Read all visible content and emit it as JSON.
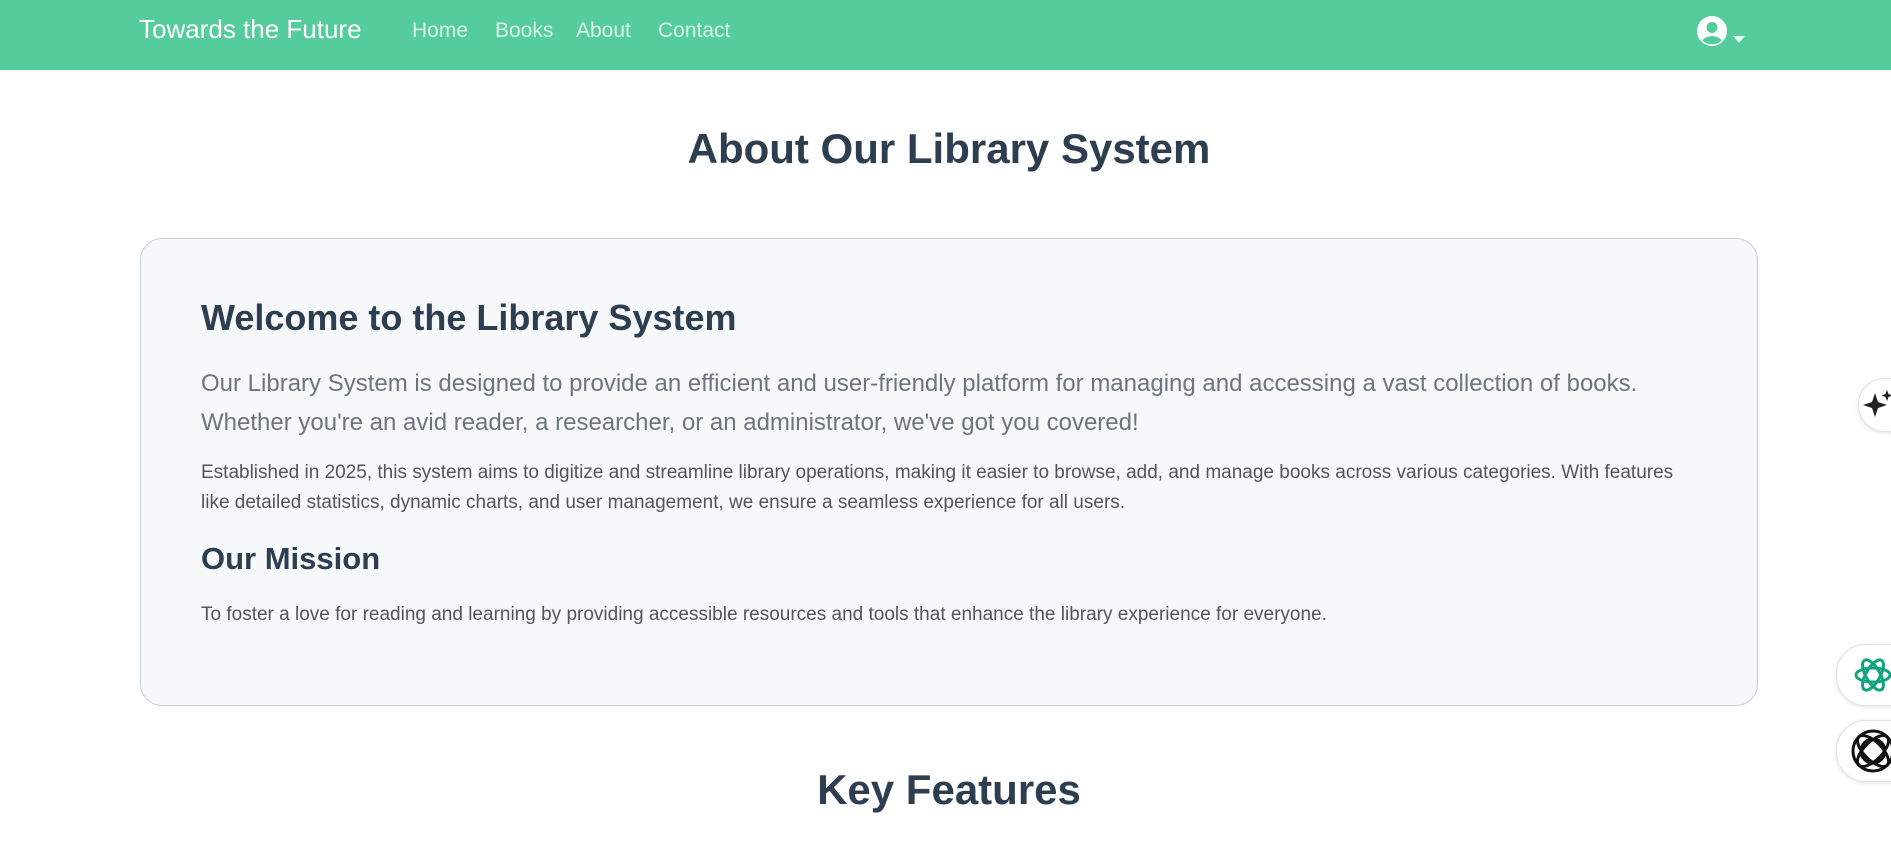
{
  "navbar": {
    "brand": "Towards the Future",
    "links": [
      {
        "label": "Home"
      },
      {
        "label": "Books"
      },
      {
        "label": "About"
      },
      {
        "label": "Contact"
      }
    ],
    "user_icon": "user-circle-icon",
    "caret_icon": "caret-down-icon",
    "background": "#55cc9c"
  },
  "page": {
    "title": "About Our Library System"
  },
  "card": {
    "title": "Welcome to the Library System",
    "lead": "Our Library System is designed to provide an efficient and user-friendly platform for managing and accessing a vast collection of books. Whether you're an avid reader, a researcher, or an administrator, we've got you covered!",
    "body": "Established in 2025, this system aims to digitize and streamline library operations, making it easier to browse, add, and manage books across various categories. With features like detailed statistics, dynamic charts, and user management, we ensure a seamless experience for all users.",
    "mission_title": "Our Mission",
    "mission_text": "To foster a love for reading and learning by providing accessible resources and tools that enhance the library experience for everyone."
  },
  "features": {
    "title": "Key Features"
  },
  "side_buttons": [
    {
      "icon": "sparkle-icon"
    },
    {
      "icon": "openai-knot-icon"
    },
    {
      "icon": "interlocked-rings-icon"
    }
  ],
  "colors": {
    "heading": "#2c3e50",
    "lead_text": "#6c757d",
    "card_bg": "#f7f8fa",
    "accent_green": "#10a37f"
  }
}
